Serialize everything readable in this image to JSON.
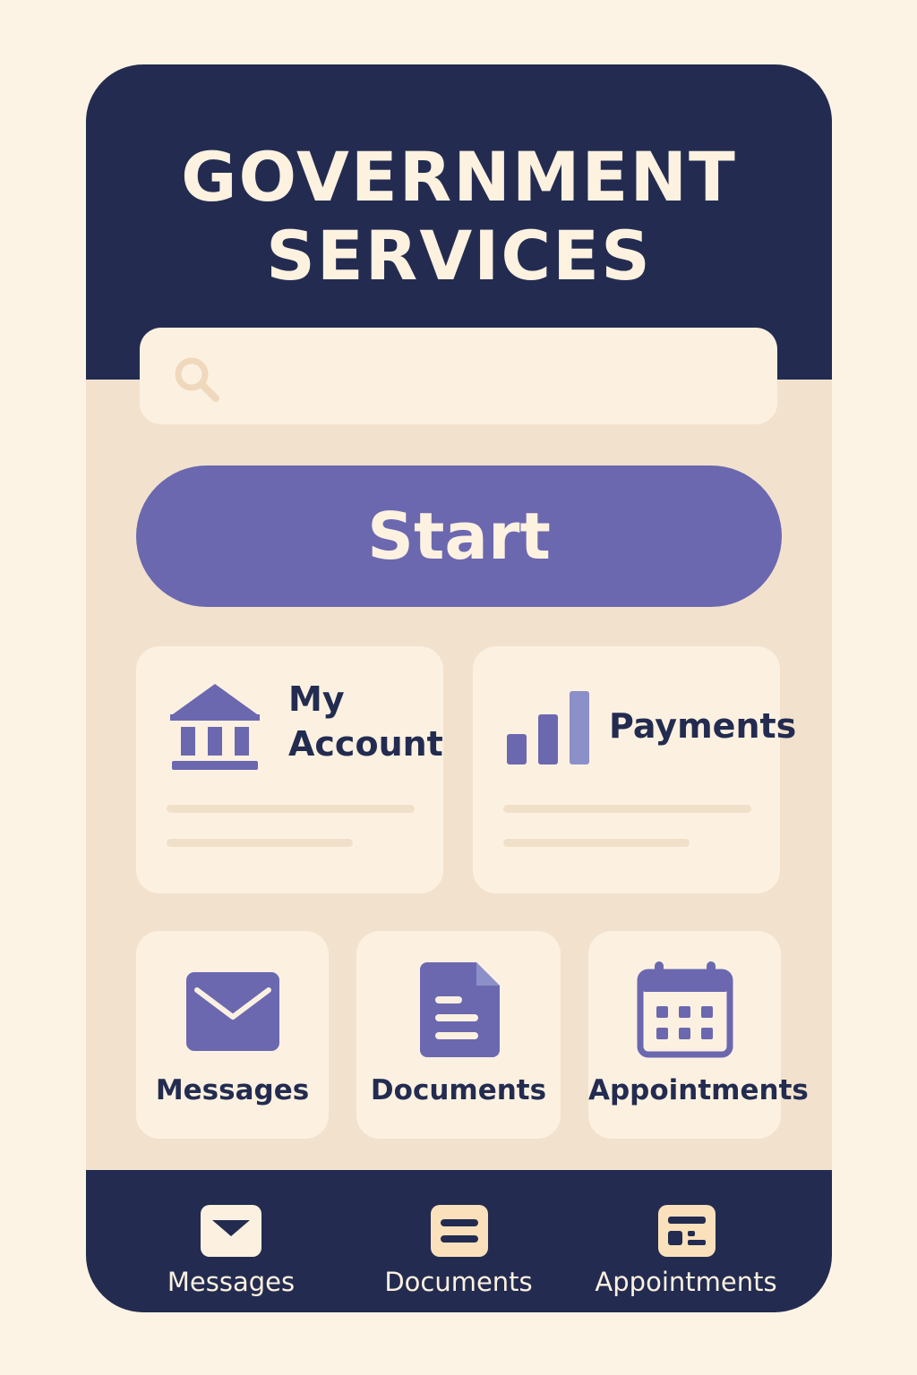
{
  "header": {
    "title_line1": "GOVERNMENT",
    "title_line2": "SERVICES"
  },
  "search": {
    "placeholder": "",
    "value": "",
    "icon": "search-icon"
  },
  "start_button": {
    "label": "Start"
  },
  "feature_cards": [
    {
      "label_line1": "My",
      "label_line2": "Account",
      "icon": "bank-icon"
    },
    {
      "label": "Payments",
      "icon": "bar-chart-icon"
    }
  ],
  "service_cards": [
    {
      "label": "Messages",
      "icon": "envelope-icon"
    },
    {
      "label": "Documents",
      "icon": "document-icon"
    },
    {
      "label": "Appointments",
      "icon": "calendar-icon"
    }
  ],
  "bottom_nav": [
    {
      "label": "Messages",
      "icon": "envelope-icon"
    },
    {
      "label": "Documents",
      "icon": "document-icon"
    },
    {
      "label": "Appointments",
      "icon": "calendar-icon"
    }
  ],
  "colors": {
    "background": "#fdf3e4",
    "header": "#232c50",
    "panel": "#f2e2cd",
    "card": "#fcf1e1",
    "accent": "#6b68b0",
    "text_dark": "#232c50",
    "text_light": "#fdf1e0"
  }
}
